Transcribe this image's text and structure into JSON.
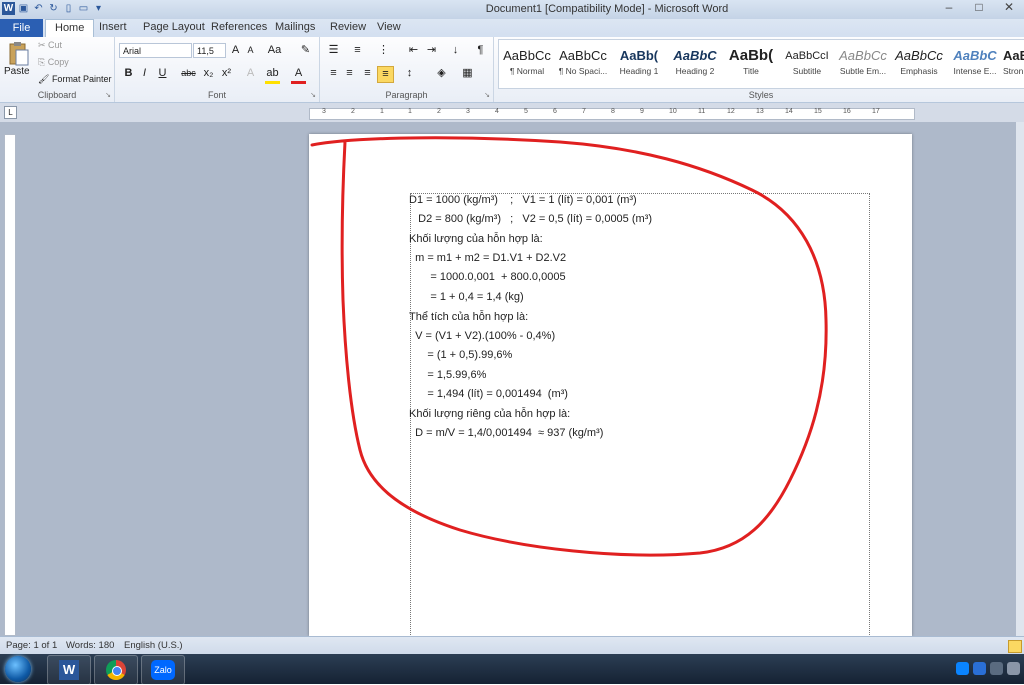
{
  "window": {
    "title": "Document1 [Compatibility Mode] - Microsoft Word"
  },
  "tabs": [
    {
      "label": "File"
    },
    {
      "label": "Home"
    },
    {
      "label": "Insert"
    },
    {
      "label": "Page Layout"
    },
    {
      "label": "References"
    },
    {
      "label": "Mailings"
    },
    {
      "label": "Review"
    },
    {
      "label": "View"
    }
  ],
  "clipboard": {
    "paste": "Paste",
    "cut": "Cut",
    "copy": "Copy",
    "format_painter": "Format Painter",
    "group": "Clipboard"
  },
  "font": {
    "name": "Arial",
    "size": "11,5",
    "group": "Font"
  },
  "paragraph": {
    "group": "Paragraph"
  },
  "styles": {
    "group": "Styles",
    "items": [
      {
        "preview": "AaBbCc",
        "name": "¶ Normal"
      },
      {
        "preview": "AaBbCc",
        "name": "¶ No Spaci..."
      },
      {
        "preview": "AaBb(",
        "name": "Heading 1"
      },
      {
        "preview": "AaBbC",
        "name": "Heading 2"
      },
      {
        "preview": "AaBb(",
        "name": "Title"
      },
      {
        "preview": "AaBbCcI",
        "name": "Subtitle"
      },
      {
        "preview": "AaBbCc",
        "name": "Subtle Em..."
      },
      {
        "preview": "AaBbCc",
        "name": "Emphasis"
      },
      {
        "preview": "AaBbC",
        "name": "Intense E..."
      },
      {
        "preview": "AaBb",
        "name": "Stron"
      }
    ]
  },
  "ruler": {
    "ticks": [
      "3",
      "2",
      "1",
      "1",
      "2",
      "3",
      "4",
      "5",
      "6",
      "7",
      "8",
      "9",
      "10",
      "11",
      "12",
      "13",
      "14",
      "15",
      "16",
      "17"
    ]
  },
  "document": {
    "lines": [
      "D1 = 1000 (kg/m³)    ;   V1 = 1 (lít) = 0,001 (m³)",
      "   D2 = 800 (kg/m³)   ;   V2 = 0,5 (lít) = 0,0005 (m³)",
      "Khối lượng của hỗn hợp là:",
      "  m = m1 + m2 = D1.V1 + D2.V2",
      "       = 1000.0,001  + 800.0,0005",
      "       = 1 + 0,4 = 1,4 (kg)",
      "Thể tích của hỗn hợp là:",
      "  V = (V1 + V2).(100% - 0,4%)",
      "      = (1 + 0,5).99,6%",
      "      = 1,5.99,6%",
      "      = 1,494 (lít) = 0,001494  (m³)",
      "Khối lượng riêng của hỗn hợp là:",
      "  D = m/V = 1,4/0,001494  ≈ 937 (kg/m³)"
    ]
  },
  "status": {
    "page": "Page: 1 of 1",
    "words": "Words: 180",
    "language": "English (U.S.)"
  },
  "taskbar": {
    "zalo": "Zalo",
    "word": "W"
  },
  "colors": {
    "ribbon_blue": "#2b579a",
    "annotation_red": "#e02020"
  }
}
